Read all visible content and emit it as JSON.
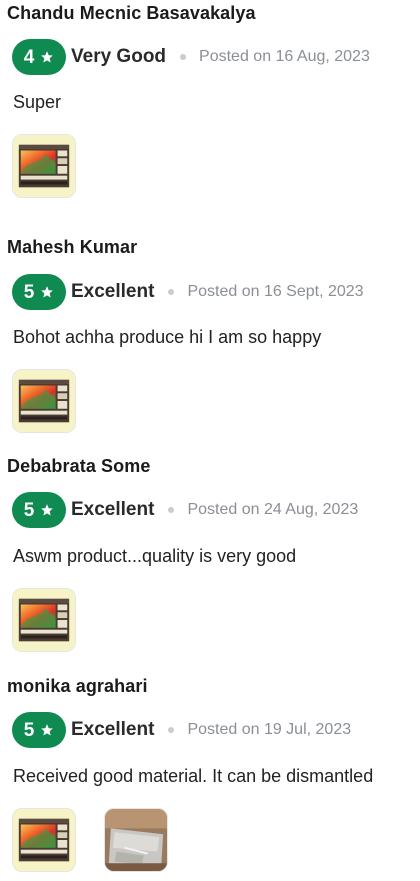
{
  "reviews": [
    {
      "name": "Chandu Mecnic Basavakalya",
      "rating": "4",
      "rating_label": "Very Good",
      "posted": "Posted on 16 Aug, 2023",
      "comment": "Super",
      "photos": [
        "tv-unit-photo"
      ]
    },
    {
      "name": "Mahesh  Kumar",
      "rating": "5",
      "rating_label": "Excellent",
      "posted": "Posted on 16 Sept, 2023",
      "comment": "Bohot achha produce hi I am so happy",
      "photos": [
        "tv-unit-photo"
      ]
    },
    {
      "name": "Debabrata Some",
      "rating": "5",
      "rating_label": "Excellent",
      "posted": "Posted on 24 Aug, 2023",
      "comment": "Aswm  product...quality  is very good",
      "photos": [
        "tv-unit-photo"
      ]
    },
    {
      "name": "monika agrahari",
      "rating": "5",
      "rating_label": "Excellent",
      "posted": "Posted on 19 Jul, 2023",
      "comment": "Received good material. It can be dismantled",
      "photos": [
        "tv-unit-photo",
        "material-closeup-photo"
      ]
    }
  ],
  "colors": {
    "rating_badge": "#0f8a50",
    "posted_text": "#8a8f96",
    "dot": "#c9ccd1"
  },
  "icons": {
    "rating_star": "star-icon"
  }
}
